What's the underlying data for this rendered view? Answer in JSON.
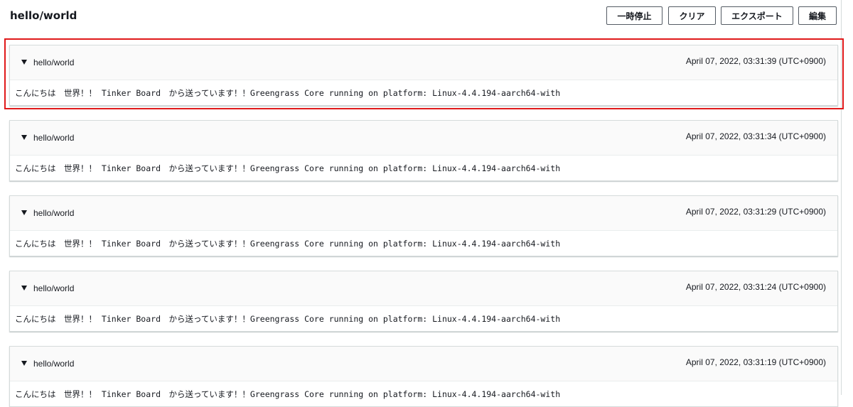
{
  "header": {
    "title": "hello/world",
    "buttons": {
      "pause": "一時停止",
      "clear": "クリア",
      "export": "エクスポート",
      "edit": "編集"
    }
  },
  "messages": [
    {
      "topic": "hello/world",
      "timestamp": "April 07, 2022, 03:31:39 (UTC+0900)",
      "body": "こんにちは　世界！！ Tinker Board　から送っています！！Greengrass Core running on platform: Linux-4.4.194-aarch64-with"
    },
    {
      "topic": "hello/world",
      "timestamp": "April 07, 2022, 03:31:34 (UTC+0900)",
      "body": "こんにちは　世界！！ Tinker Board　から送っています！！Greengrass Core running on platform: Linux-4.4.194-aarch64-with"
    },
    {
      "topic": "hello/world",
      "timestamp": "April 07, 2022, 03:31:29 (UTC+0900)",
      "body": "こんにちは　世界！！ Tinker Board　から送っています！！Greengrass Core running on platform: Linux-4.4.194-aarch64-with"
    },
    {
      "topic": "hello/world",
      "timestamp": "April 07, 2022, 03:31:24 (UTC+0900)",
      "body": "こんにちは　世界！！ Tinker Board　から送っています！！Greengrass Core running on platform: Linux-4.4.194-aarch64-with"
    },
    {
      "topic": "hello/world",
      "timestamp": "April 07, 2022, 03:31:19 (UTC+0900)",
      "body": "こんにちは　世界！！ Tinker Board　から送っています！！Greengrass Core running on platform: Linux-4.4.194-aarch64-with"
    }
  ],
  "colors": {
    "highlight": "#e0191a",
    "header_bg": "#fafafa",
    "border": "#d5dbdb"
  },
  "icons": {
    "caret": "caret-down-icon"
  }
}
